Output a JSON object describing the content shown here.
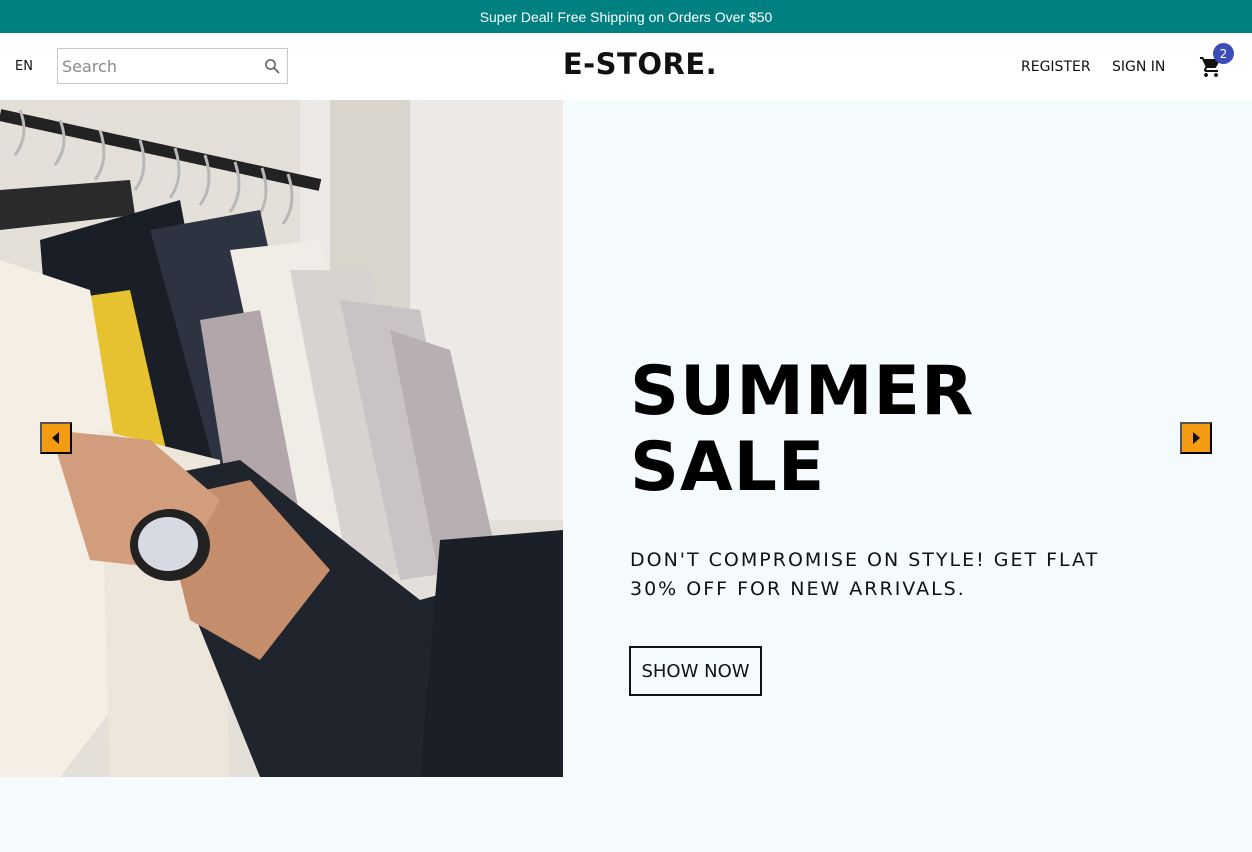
{
  "announcement": {
    "text": "Super Deal! Free Shipping on Orders Over $50"
  },
  "navbar": {
    "language": "EN",
    "search_placeholder": "Search",
    "logo": "E-STORE.",
    "register": "REGISTER",
    "sign_in": "SIGN IN",
    "cart_count": "2"
  },
  "slide": {
    "title_line1": "SUMMER",
    "title_line2": "SALE",
    "description_line1": "DON'T COMPROMISE ON STYLE! GET FLAT",
    "description_line2": "30% OFF FOR NEW ARRIVALS.",
    "button": "SHOW NOW"
  },
  "colors": {
    "announcement_bg": "#008080",
    "slide_bg": "#f5fafd",
    "arrow_bg": "#f39c12",
    "badge_bg": "#3d4db7"
  },
  "icons": {
    "search": "search-icon",
    "cart": "cart-icon",
    "prev": "arrow-left-icon",
    "next": "arrow-right-icon"
  }
}
